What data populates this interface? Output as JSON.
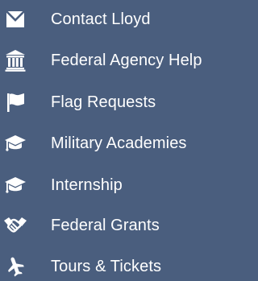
{
  "nav": {
    "items": [
      {
        "label": "Contact Lloyd",
        "icon": "envelope-icon"
      },
      {
        "label": "Federal Agency Help",
        "icon": "government-building-icon"
      },
      {
        "label": "Flag Requests",
        "icon": "flag-icon"
      },
      {
        "label": "Military Academies",
        "icon": "graduation-cap-icon"
      },
      {
        "label": "Internship",
        "icon": "graduation-cap-icon"
      },
      {
        "label": "Federal Grants",
        "icon": "handshake-icon"
      },
      {
        "label": "Tours & Tickets",
        "icon": "airplane-icon"
      }
    ]
  },
  "colors": {
    "background": "#4a5e7e",
    "text": "#ffffff",
    "icon": "#ffffff"
  }
}
